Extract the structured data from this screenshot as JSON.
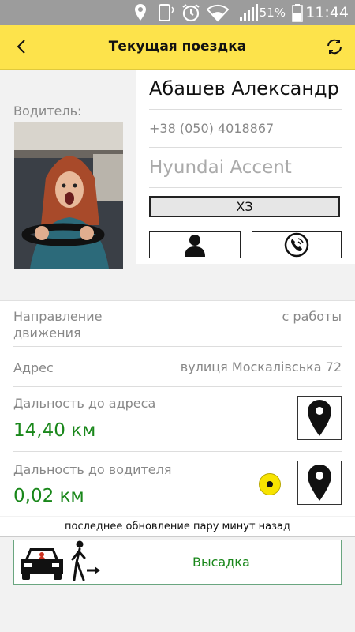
{
  "status_bar": {
    "battery_percent": "51%",
    "time": "11:44"
  },
  "app_bar": {
    "title": "Текущая поездка"
  },
  "driver": {
    "label": "Водитель:",
    "name": "Абашев Александр",
    "phone": "+38 (050) 4018867",
    "car": "Hyundai Accent",
    "plate": "ХЗ"
  },
  "trip": {
    "direction_label": "Направление движения",
    "direction_value": "с работы",
    "address_label": "Адрес",
    "address_value": "вулиця Москалівська 72",
    "distance_to_address_label": "Дальность до адреса",
    "distance_to_address_value": "14,40 км",
    "distance_to_driver_label": "Дальность до водителя",
    "distance_to_driver_value": "0,02 км"
  },
  "last_update": "последнее обновление пару минут назад",
  "dropoff_button": {
    "label": "Высадка"
  },
  "colors": {
    "app_bar": "#fde34b",
    "status_bar": "#9c9c9c",
    "accent_green": "#19871a",
    "marker_yellow": "#f7e300"
  },
  "icons": [
    "location-icon",
    "phone-rotate-icon",
    "alarm-icon",
    "wifi-icon",
    "signal-icon",
    "battery-icon",
    "back-arrow-icon",
    "refresh-icon",
    "person-icon",
    "phone-call-icon",
    "map-pin-icon",
    "car-icon",
    "walking-person-icon"
  ]
}
